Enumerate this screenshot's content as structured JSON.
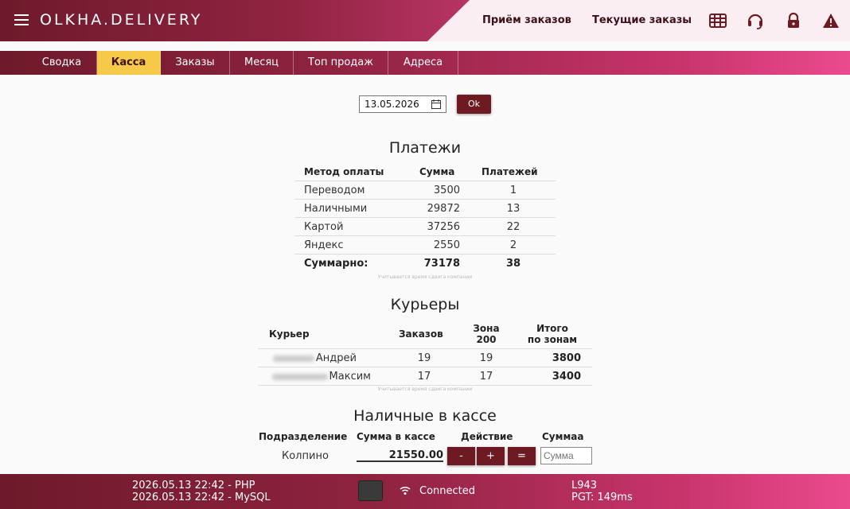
{
  "header": {
    "logo": "OLKHA.DELIVERY",
    "nav": [
      "Приём заказов",
      "Текущие заказы"
    ]
  },
  "tabs": [
    "Сводка",
    "Касса",
    "Заказы",
    "Месяц",
    "Топ продаж",
    "Адреса"
  ],
  "active_tab": "Касса",
  "date_field": {
    "value": "13.05.2026"
  },
  "ok_label": "Ok",
  "payments": {
    "title": "Платежи",
    "headers": [
      "Метод оплаты",
      "Сумма",
      "Платежей"
    ],
    "rows": [
      [
        "Переводом",
        "3500",
        "1"
      ],
      [
        "Наличными",
        "29872",
        "13"
      ],
      [
        "Картой",
        "37256",
        "22"
      ],
      [
        "Яндекс",
        "2550",
        "2"
      ]
    ],
    "total": [
      "Суммарно:",
      "73178",
      "38"
    ],
    "note": "Учитывается время сдвига компании"
  },
  "couriers": {
    "title": "Курьеры",
    "headers": [
      "Курьер",
      "Заказов",
      "Зона",
      "200",
      "Итого",
      "по зонам"
    ],
    "rows": [
      [
        "Андрей",
        "19",
        "19",
        "3800"
      ],
      [
        "Максим",
        "17",
        "17",
        "3400"
      ]
    ],
    "note": "Учитывается время сдвига компании"
  },
  "cash": {
    "title": "Наличные в кассе",
    "headers": [
      "Подразделение",
      "Сумма в кассе",
      "Действие",
      "Суммаа"
    ],
    "division": "Колпино",
    "sum": "21550.00",
    "actions": [
      "-",
      "+",
      "="
    ],
    "input_placeholder": "Сумма"
  },
  "footer": {
    "php": "2026.05.13 22:42 - PHP",
    "mysql": "2026.05.13 22:42 - MySQL",
    "status": "Connected",
    "line": "L943",
    "pgt": "PGT: 149ms"
  },
  "colors": {
    "accent": "#6e1a2b",
    "tab_active": "#f7c948",
    "pink": "#ea4b8d"
  }
}
